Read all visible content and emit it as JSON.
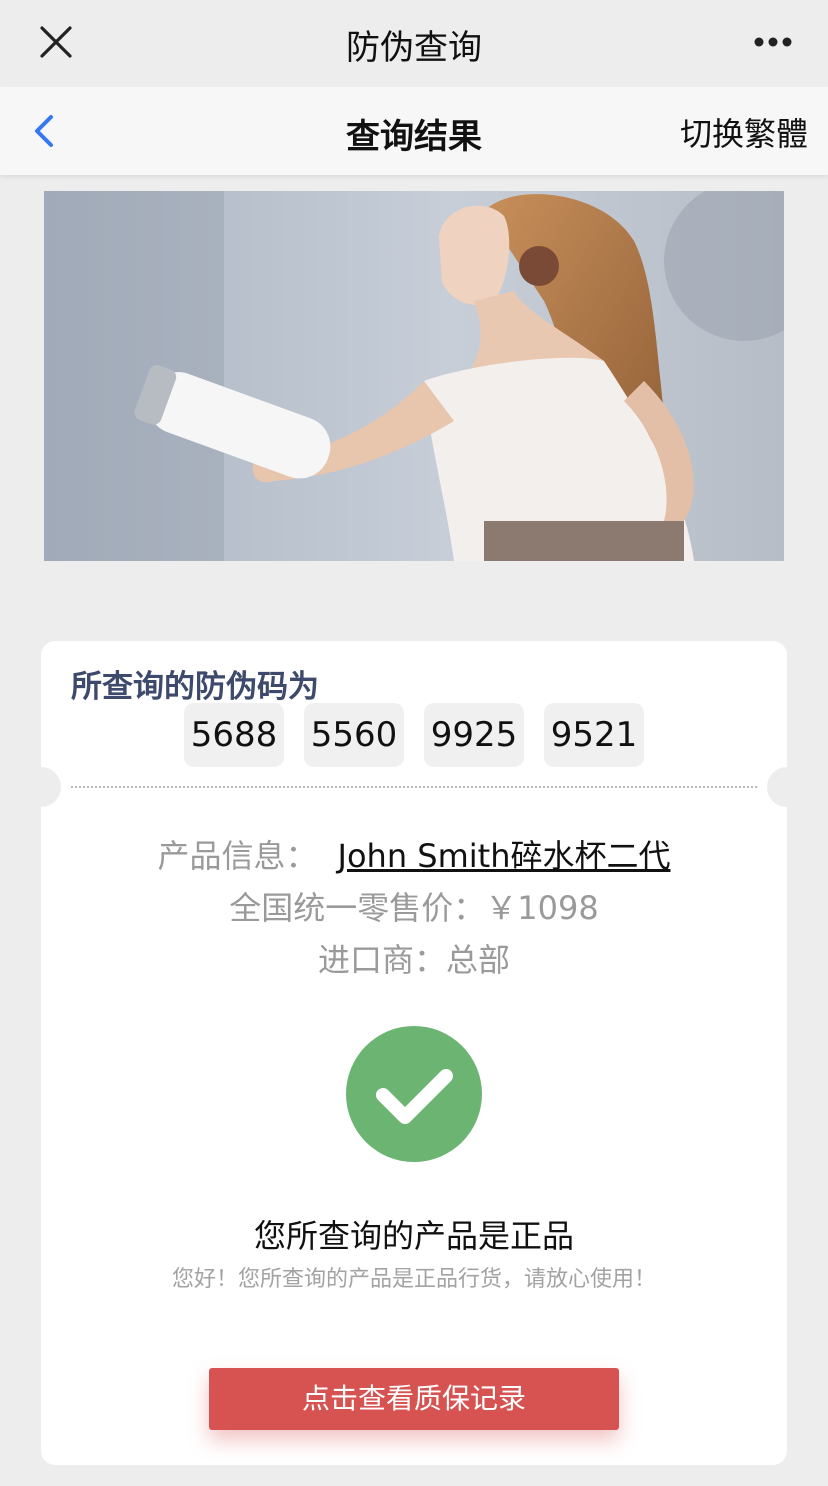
{
  "top_bar": {
    "title": "防伪查询"
  },
  "nav_bar": {
    "title": "查询结果",
    "right_label": "切换繁體",
    "accent_color": "#3478f6"
  },
  "code_section": {
    "title": "所查询的防伪码为",
    "codes": [
      "5688",
      "5560",
      "9925",
      "9521"
    ]
  },
  "product_info": {
    "product_label": "产品信息：",
    "product_name": "John Smith碎水杯二代",
    "price_label": "全国统一零售价：",
    "price_value": "￥1098",
    "importer_label": "进口商：",
    "importer_value": "总部"
  },
  "result": {
    "icon": "check-circle-icon",
    "icon_color": "#6cb472",
    "title": "您所查询的产品是正品",
    "subtitle": "您好！您所查询的产品是正品行货，请放心使用！"
  },
  "actions": {
    "warranty_button": "点击查看质保记录",
    "button_color": "#d65351"
  }
}
